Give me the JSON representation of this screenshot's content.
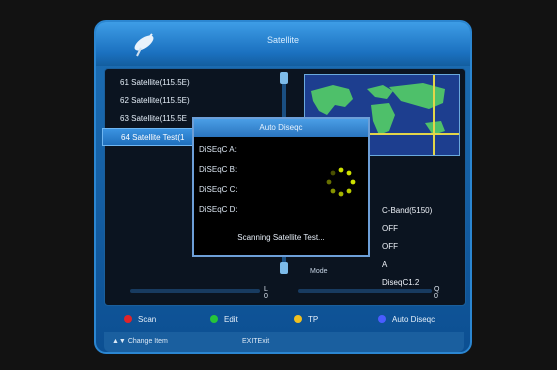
{
  "window": {
    "title": "Satellite"
  },
  "satellites": [
    {
      "label": "61 Satellite(115.5E)",
      "selected": false
    },
    {
      "label": "62 Satellite(115.5E)",
      "selected": false
    },
    {
      "label": "63 Satellite(115.5E",
      "selected": false
    },
    {
      "label": "64 Satellite Test(1",
      "selected": true
    }
  ],
  "params": {
    "band": "C-Band(5150)",
    "p2": "OFF",
    "p3": "OFF",
    "p4": "A",
    "diseqc": "DiseqC1.2",
    "mode_label": "Mode"
  },
  "signal": {
    "level_label": "L 0",
    "quality_label": "Q 0",
    "level": 0,
    "quality": 0
  },
  "dialog": {
    "title": "Auto Diseqc",
    "ports": [
      "DiSEqC A:",
      "DiSEqC B:",
      "DiSEqC C:",
      "DiSEqC D:"
    ],
    "status": "Scanning Satellite Test..."
  },
  "legend": [
    {
      "label": "Scan",
      "color": "#e0242a"
    },
    {
      "label": "Edit",
      "color": "#26c43a"
    },
    {
      "label": "TP",
      "color": "#f0c020"
    },
    {
      "label": "Auto Diseqc",
      "color": "#4a5cff"
    }
  ],
  "footer": {
    "change_label": "Change Item",
    "exit_label": "EXITExit"
  },
  "colors": {
    "panel": "#1d6fb5",
    "accent": "#3b93e1",
    "crosshair": "#e2d54a",
    "spinner": "#cde000"
  }
}
